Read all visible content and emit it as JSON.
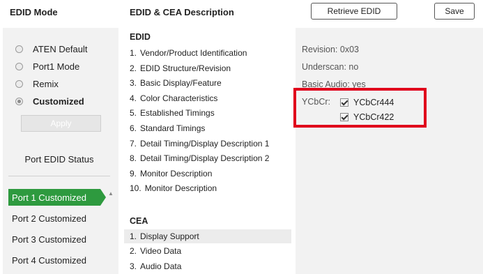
{
  "header": {
    "edid_mode_title": "EDID Mode",
    "description_title": "EDID & CEA Description",
    "retrieve_label": "Retrieve EDID",
    "save_label": "Save"
  },
  "edid_mode": {
    "options": [
      {
        "label": "ATEN Default",
        "selected": false
      },
      {
        "label": "Port1 Mode",
        "selected": false
      },
      {
        "label": "Remix",
        "selected": false
      },
      {
        "label": "Customized",
        "selected": true
      }
    ],
    "apply_label": "Apply"
  },
  "port_status": {
    "title": "Port EDID Status",
    "ports": [
      {
        "label": "Port 1  Customized",
        "active": true
      },
      {
        "label": "Port 2  Customized",
        "active": false
      },
      {
        "label": "Port 3  Customized",
        "active": false
      },
      {
        "label": "Port 4  Customized",
        "active": false
      }
    ]
  },
  "edid_list": {
    "title": "EDID",
    "items": [
      {
        "num": "1.",
        "label": "Vendor/Product Identification"
      },
      {
        "num": "2.",
        "label": "EDID Structure/Revision"
      },
      {
        "num": "3.",
        "label": "Basic Display/Feature"
      },
      {
        "num": "4.",
        "label": "Color Characteristics"
      },
      {
        "num": "5.",
        "label": "Established Timings"
      },
      {
        "num": "6.",
        "label": "Standard Timings"
      },
      {
        "num": "7.",
        "label": "Detail Timing/Display Description 1"
      },
      {
        "num": "8.",
        "label": "Detail Timing/Display Description 2"
      },
      {
        "num": "9.",
        "label": "Monitor Description"
      },
      {
        "num": "10.",
        "label": "Monitor Description"
      }
    ]
  },
  "cea_list": {
    "title": "CEA",
    "items": [
      {
        "num": "1.",
        "label": "Display Support",
        "selected": true
      },
      {
        "num": "2.",
        "label": "Video Data",
        "selected": false
      },
      {
        "num": "3.",
        "label": "Audio Data",
        "selected": false
      }
    ]
  },
  "detail": {
    "revision": "Revision: 0x03",
    "underscan": "Underscan: no",
    "basic_audio": "Basic Audio: yes",
    "ycbcr_label": "YCbCr:",
    "ycbcr_options": [
      {
        "label": "YCbCr444",
        "checked": true
      },
      {
        "label": "YCbCr422",
        "checked": true
      }
    ]
  },
  "colors": {
    "active_port": "#2e9a3f",
    "highlight": "#e0001b",
    "panel_bg": "#f2f2f2"
  }
}
